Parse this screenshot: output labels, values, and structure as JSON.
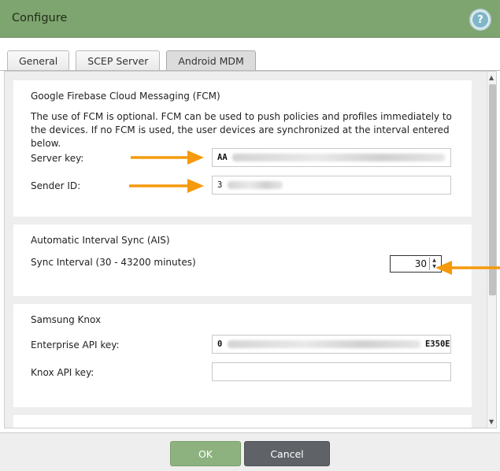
{
  "window": {
    "title": "Configure",
    "help_icon": "question-mark-icon",
    "help_glyph": "?"
  },
  "tabs": [
    {
      "label": "General",
      "active": false
    },
    {
      "label": "SCEP Server",
      "active": false
    },
    {
      "label": "Android MDM",
      "active": true
    }
  ],
  "fcm": {
    "title": "Google Firebase Cloud Messaging (FCM)",
    "description": "The use of FCM is optional. FCM can be used to push policies and profiles immediately to the devices. If no FCM is used, the user devices are synchronized at the interval entered below.",
    "server_key_label": "Server key:",
    "server_key_value": "AA",
    "sender_id_label": "Sender ID:",
    "sender_id_value": "3"
  },
  "ais": {
    "title": "Automatic Interval Sync (AIS)",
    "sync_label": "Sync Interval (30 - 43200 minutes)",
    "sync_value": "30"
  },
  "knox": {
    "title": "Samsung Knox",
    "enterprise_label": "Enterprise API key:",
    "enterprise_value_start": "0",
    "enterprise_value_end": "E350E",
    "knox_label": "Knox API key:",
    "knox_value": ""
  },
  "footer": {
    "ok_label": "OK",
    "cancel_label": "Cancel"
  },
  "colors": {
    "titlebar": "#7ea46f",
    "arrow": "#f59a0c",
    "ok": "#8db27f",
    "cancel": "#5f6368"
  }
}
